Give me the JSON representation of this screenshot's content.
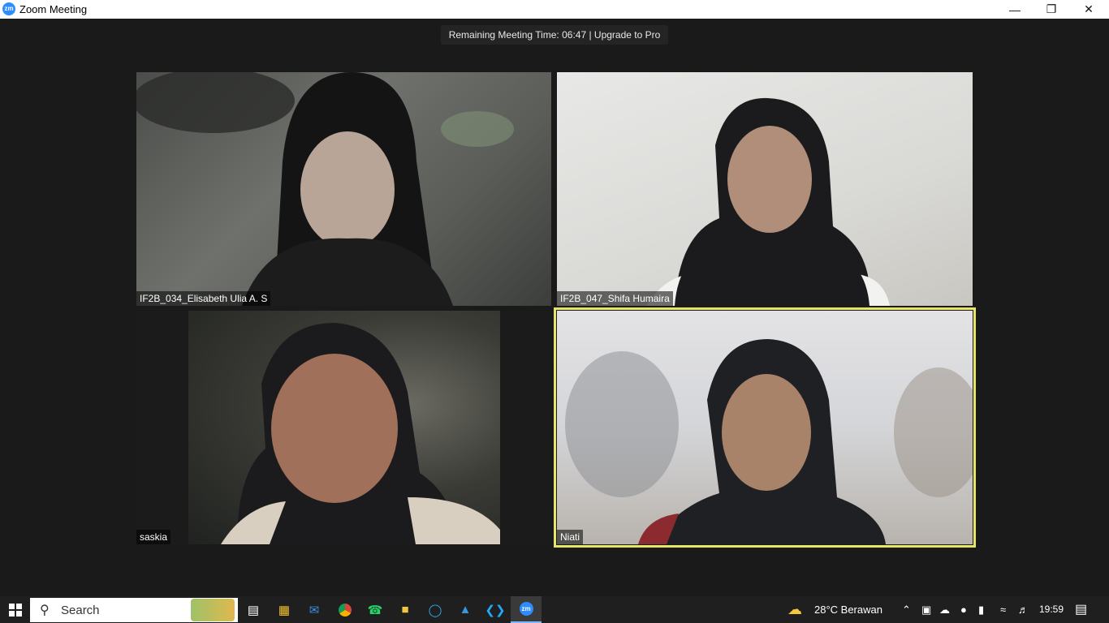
{
  "window": {
    "title": "Zoom Meeting",
    "app_icon_text": "zm"
  },
  "meeting": {
    "remaining_time_text": "Remaining Meeting Time: 06:47 | Upgrade to Pro",
    "participants": [
      {
        "name": "IF2B_034_Elisabeth Ulia A. S"
      },
      {
        "name": "IF2B_047_Shifa Humaira"
      },
      {
        "name": "saskia"
      },
      {
        "name": "Niati",
        "active_speaker": true
      }
    ]
  },
  "taskbar": {
    "search_label": "Search",
    "weather": "28°C  Berawan",
    "time": "19:59"
  },
  "colors": {
    "background": "#1a1a1a",
    "active_speaker_border": "#e7e46a",
    "zoom_blue": "#2d8cff"
  }
}
